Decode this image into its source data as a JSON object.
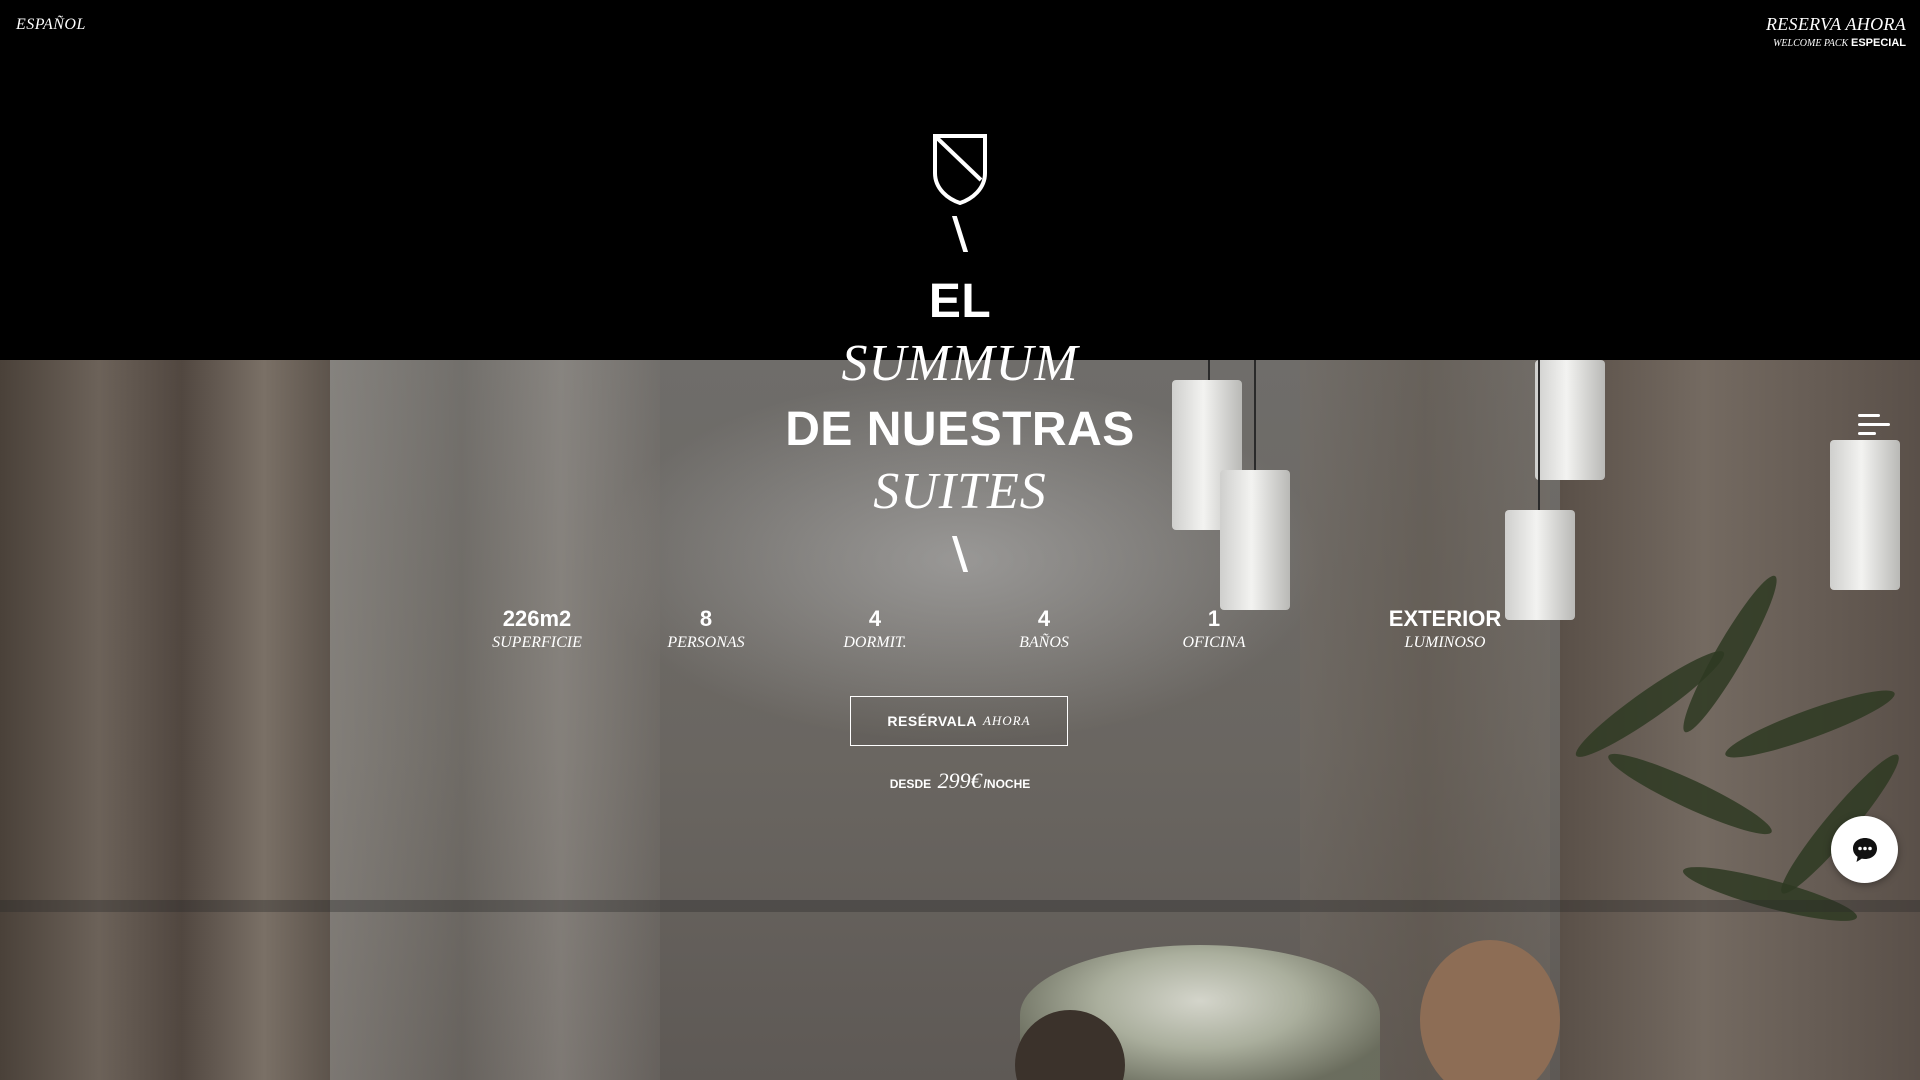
{
  "header": {
    "language": "ESPAÑOL",
    "reserve_label": "RESERVA AHORA",
    "welcome_italic": "WELCOME PACK",
    "welcome_bold": "ESPECIAL"
  },
  "hero": {
    "slash_top": "\\",
    "line1": "EL",
    "line2": "SUMMUM",
    "line3": "DE NUESTRAS",
    "line4": "SUITES",
    "slash_bottom": "\\"
  },
  "stats": [
    {
      "value": "226m2",
      "label": "SUPERFICIE"
    },
    {
      "value": "8",
      "label": "PERSONAS"
    },
    {
      "value": "4",
      "label": "DORMIT."
    },
    {
      "value": "4",
      "label": "BAÑOS"
    },
    {
      "value": "1",
      "label": "OFICINA"
    },
    {
      "value": "EXTERIOR",
      "label": "LUMINOSO"
    }
  ],
  "cta": {
    "bold": "RESÉRVALA",
    "italic": "AHORA"
  },
  "price": {
    "prefix": "DESDE",
    "amount": "299€",
    "suffix": "/NOCHE"
  },
  "icons": {
    "logo": "shield-logo-icon",
    "menu": "hamburger-menu-icon",
    "chat": "chat-bubble-icon"
  },
  "colors": {
    "background": "#000000",
    "text": "#ffffff"
  }
}
